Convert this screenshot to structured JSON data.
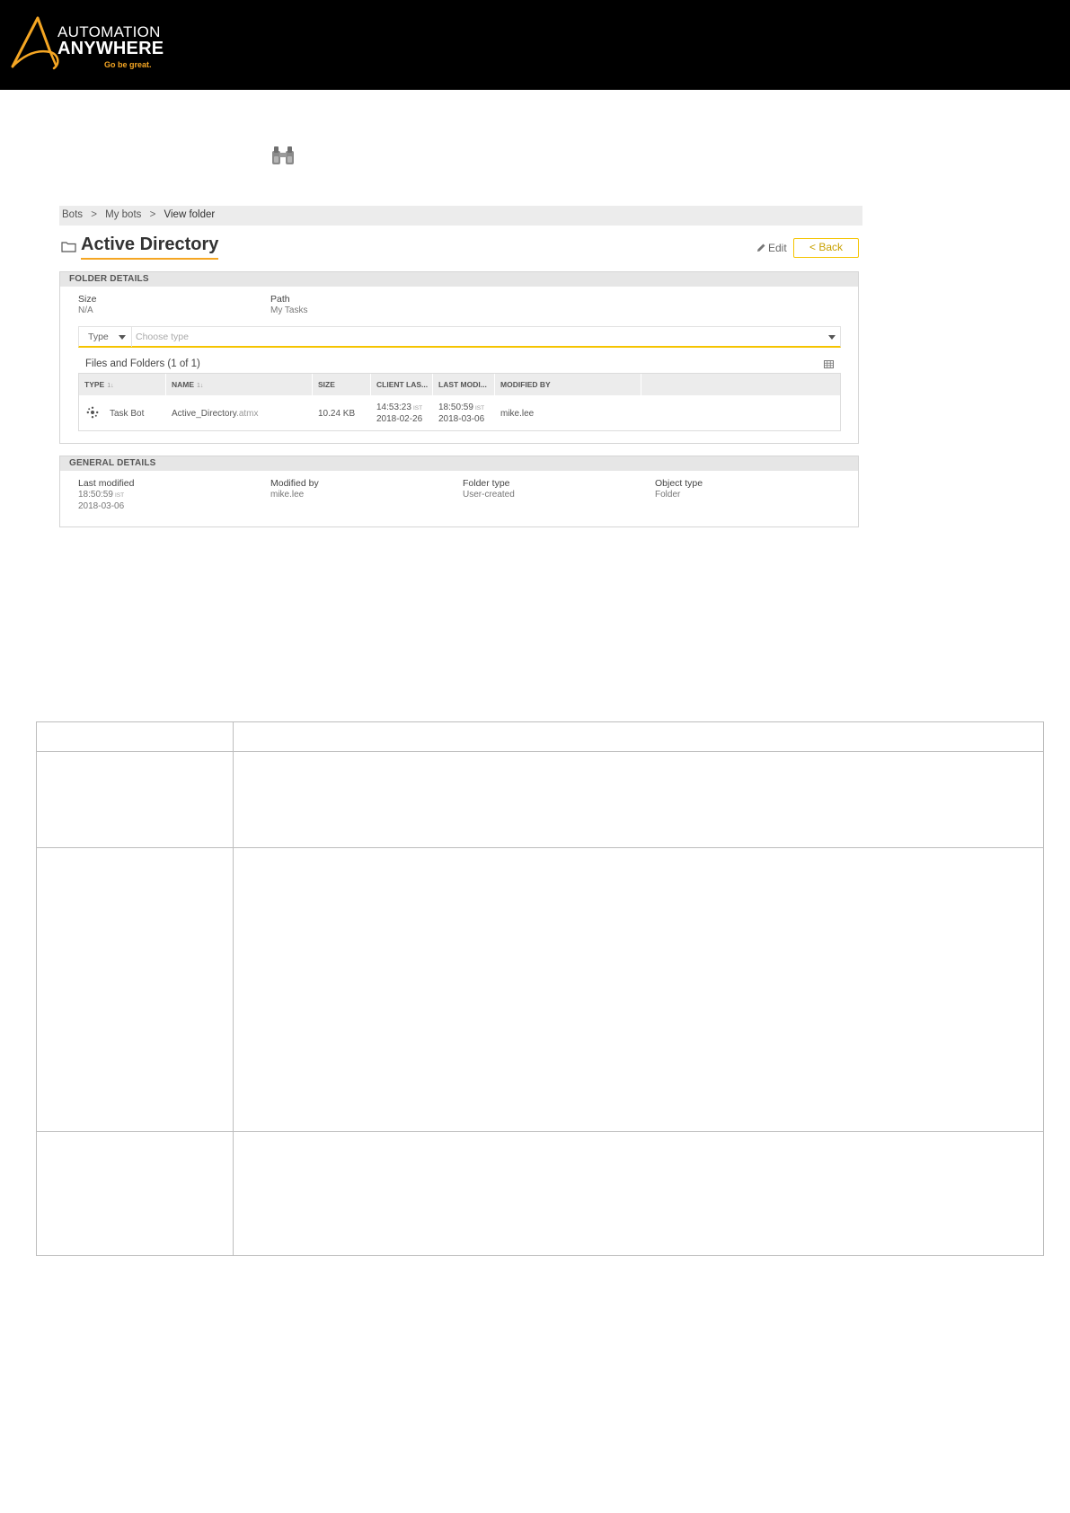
{
  "header": {
    "brand_line1": "AUTOMATION",
    "brand_line2": "ANYWHERE",
    "tagline": "Go be great.",
    "accent_color": "#f5a623"
  },
  "icons": {
    "top_icon": "binoculars-icon"
  },
  "panel": {
    "breadcrumb": [
      "Bots",
      "My bots",
      "View folder"
    ],
    "breadcrumb_separator": ">",
    "title": "Active Directory",
    "edit_label": "Edit",
    "back_label": "< Back",
    "folder_details": {
      "heading": "FOLDER DETAILS",
      "size_label": "Size",
      "size_value": "N/A",
      "path_label": "Path",
      "path_value": "My Tasks"
    },
    "filter": {
      "type_label": "Type",
      "placeholder": "Choose type"
    },
    "files": {
      "title": "Files and Folders",
      "count": "(1 of 1)",
      "columns": [
        "TYPE",
        "NAME",
        "SIZE",
        "CLIENT LAS...",
        "LAST MODI...",
        "MODIFIED BY"
      ],
      "sort_glyphs": [
        "1↓",
        "1↓"
      ],
      "rows": [
        {
          "type": "Task Bot",
          "name": "Active_Directory",
          "ext": ".atmx",
          "size": "10.24 KB",
          "client_time": "14:53:23",
          "client_zone": "IST",
          "client_date": "2018-02-26",
          "modified_time": "18:50:59",
          "modified_zone": "IST",
          "modified_date": "2018-03-06",
          "modified_by": "mike.lee"
        }
      ]
    },
    "general_details": {
      "heading": "GENERAL DETAILS",
      "last_modified_label": "Last modified",
      "last_modified_time": "18:50:59",
      "last_modified_zone": "IST",
      "last_modified_date": "2018-03-06",
      "modified_by_label": "Modified by",
      "modified_by_value": "mike.lee",
      "folder_type_label": "Folder type",
      "folder_type_value": "User-created",
      "object_type_label": "Object type",
      "object_type_value": "Folder"
    }
  }
}
